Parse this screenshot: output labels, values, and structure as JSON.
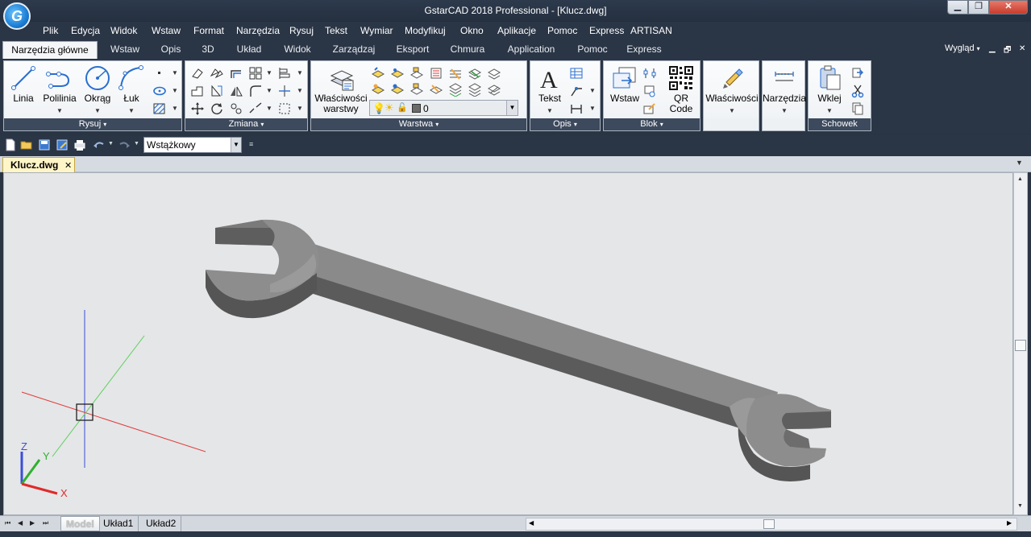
{
  "window": {
    "title": "GstarCAD 2018 Professional - [Klucz.dwg]",
    "logo_letter": "G",
    "minimize_glyph": "▁",
    "maximize_glyph": "❐",
    "close_glyph": "✕"
  },
  "menu": [
    "Plik",
    "Edycja",
    "Widok",
    "Wstaw",
    "Format",
    "Narzędzia",
    "Rysuj",
    "Tekst",
    "Wymiar",
    "Modyfikuj",
    "Okno",
    "Aplikacje",
    "Pomoc",
    "Express",
    "ARTISAN"
  ],
  "ribbon_tabs": [
    "Narzędzia główne",
    "Wstaw",
    "Opis",
    "3D",
    "Układ",
    "Widok",
    "Zarządzaj",
    "Eksport",
    "Chmura",
    "Application",
    "Pomoc",
    "Express"
  ],
  "ribbon_right": {
    "wyglad": "Wygląd",
    "caret": "▾",
    "restore": "🗗",
    "close": "✕"
  },
  "panels": {
    "rysuj": {
      "label": "Rysuj",
      "tools": [
        "Linia",
        "Polilinia",
        "Okrąg",
        "Łuk"
      ]
    },
    "zmiana": {
      "label": "Zmiana"
    },
    "warstwa": {
      "label": "Warstwa",
      "big_tool": "Właściwości warstwy",
      "layer_value": "0"
    },
    "opis": {
      "label": "Opis",
      "big_tool": "Tekst"
    },
    "blok": {
      "label": "Blok",
      "tools": [
        "Wstaw",
        "QR Code"
      ]
    },
    "wlasciwosci": {
      "big_tool": "Właściwości"
    },
    "narzedzia": {
      "big_tool": "Narzędzia"
    },
    "schowek": {
      "label": "Schowek",
      "big_tool": "Wklej"
    }
  },
  "quick_access": {
    "workspace": "Wstążkowy"
  },
  "document_tabs": [
    {
      "name": "Klucz.dwg",
      "close": "✕"
    }
  ],
  "layout_tabs": [
    "Model",
    "Układ1",
    "Układ2"
  ],
  "ucs": {
    "x_label": "X",
    "y_label": "Y",
    "z_label": "Z"
  },
  "colors": {
    "chrome": "#2a3545",
    "canvas": "#e5e6e8",
    "active_doc_tab": "#fff6c8"
  }
}
